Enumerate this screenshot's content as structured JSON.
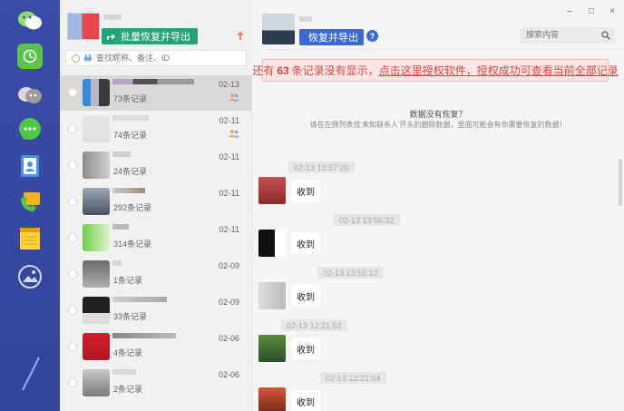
{
  "rail": {
    "icons": [
      "wechat-icon",
      "restore-icon",
      "qq-icon",
      "message-icon",
      "contacts-icon",
      "callrecord-icon",
      "notes-icon",
      "photos-icon",
      "pen-icon"
    ],
    "active": "restore-icon"
  },
  "contacts": {
    "batch_button": "批量恢复并导出",
    "search_placeholder": "查找昵称、备注、ID",
    "rows": [
      {
        "count": "73条记录",
        "date": "02-13",
        "group": true,
        "selected": true
      },
      {
        "count": "74条记录",
        "date": "02-11",
        "group": true,
        "selected": false
      },
      {
        "count": "24条记录",
        "date": "02-11",
        "group": false,
        "selected": false
      },
      {
        "count": "292条记录",
        "date": "02-11",
        "group": false,
        "selected": false
      },
      {
        "count": "314条记录",
        "date": "02-11",
        "group": false,
        "selected": false
      },
      {
        "count": "1条记录",
        "date": "02-09",
        "group": false,
        "selected": false
      },
      {
        "count": "33条记录",
        "date": "02-09",
        "group": false,
        "selected": false
      },
      {
        "count": "4条记录",
        "date": "02-06",
        "group": false,
        "selected": false
      },
      {
        "count": "2条记录",
        "date": "02-06",
        "group": false,
        "selected": false
      }
    ]
  },
  "chat": {
    "restore_button": "恢复并导出",
    "help": "?",
    "window": {
      "minimize": "–",
      "maximize": "□",
      "close": "×"
    },
    "search_placeholder": "搜索内容",
    "notice": {
      "prefix": "还有",
      "count": "63",
      "middle": "条记录没有显示，",
      "link": "点击这里授权软件，授权成功可查看当前全部记录"
    },
    "tip_title": "数据没有恢复？",
    "tip_body": "请在左侧列表找'未知联系人'开头的删除数据，里面可能会有你需要恢复的数据！",
    "messages": [
      {
        "time": "02-13 13:57:20",
        "text": "收到"
      },
      {
        "time": "02-13 13:56:32",
        "text": "收到"
      },
      {
        "time": "02-13 13:55:12",
        "text": "收到"
      },
      {
        "time": "02-13 12:21:52",
        "text": "收到"
      },
      {
        "time": "02-13 12:21:04",
        "text": "收到"
      }
    ]
  },
  "colors": {
    "rail": "#3d4ca6",
    "green_button": "#24a37a",
    "blue_button": "#3b6bd0",
    "notice_text": "#e0463f"
  }
}
